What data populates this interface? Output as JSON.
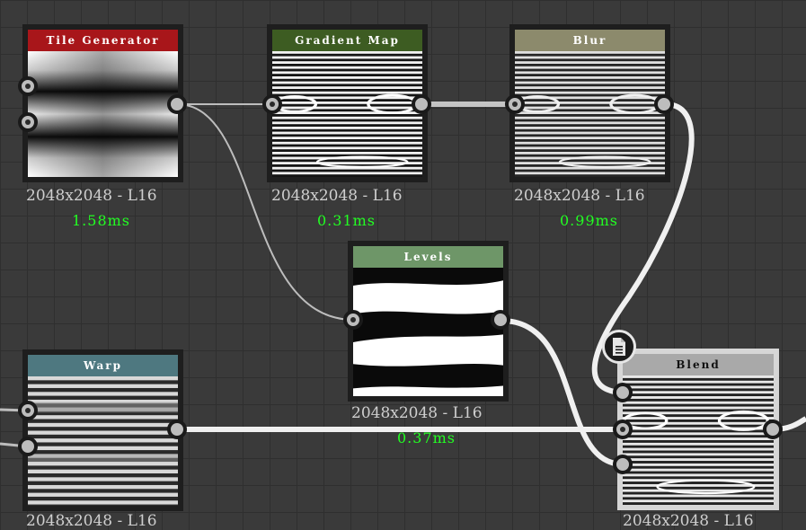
{
  "colors": {
    "background": "#3a3a3a",
    "node_frame": "#1e1e1e",
    "selected_frame": "#d6d6d6",
    "timing_text": "#22ff22",
    "resolution_text": "#cfcfcf"
  },
  "nodes": {
    "tile_generator": {
      "title": "Tile Generator",
      "header_color": "#a8161a",
      "resolution": "2048x2048 - L16",
      "timing": "1.58ms"
    },
    "gradient_map": {
      "title": "Gradient Map",
      "header_color": "#3d5c22",
      "resolution": "2048x2048 - L16",
      "timing": "0.31ms"
    },
    "blur": {
      "title": "Blur",
      "header_color": "#8c8a6c",
      "resolution": "2048x2048 - L16",
      "timing": "0.99ms"
    },
    "levels": {
      "title": "Levels",
      "header_color": "#6e9668",
      "resolution": "2048x2048 - L16",
      "timing": "0.37ms"
    },
    "warp": {
      "title": "Warp",
      "header_color": "#4e7880",
      "resolution": "2048x2048 - L16"
    },
    "blend": {
      "title": "Blend",
      "header_color": "#a9a9a9",
      "resolution": "2048x2048 - L16",
      "selected": true,
      "badge_icon": "document-icon"
    }
  }
}
